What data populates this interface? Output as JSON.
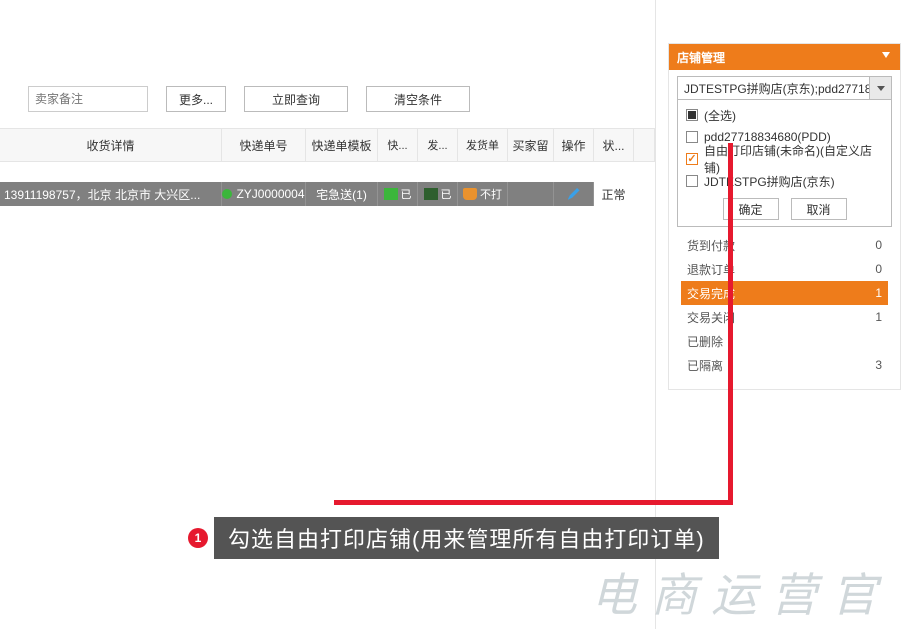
{
  "toolbar": {
    "placeholder_note": "卖家备注",
    "btn_more": "更多...",
    "btn_query": "立即查询",
    "btn_clear": "清空条件"
  },
  "columns": {
    "recv": "收货详情",
    "trk": "快递单号",
    "tpl": "快递单模板",
    "exp": "快...",
    "send": "发...",
    "ship": "发货单",
    "buyer": "买家留",
    "op": "操作",
    "stat": "状..."
  },
  "row": {
    "recv": "13911198757，北京 北京市 大兴区...",
    "trk": "ZYJ0000004",
    "tpl": "宅急送(1)",
    "exp_txt": "已",
    "send_txt": "已",
    "ship_txt": "不打",
    "stat": "正常"
  },
  "panel": {
    "title": "店铺管理",
    "select_text": "JDTESTPG拼购店(京东);pdd27718...",
    "opts": {
      "all": "(全选)",
      "pdd": "pdd27718834680(PDD)",
      "free": "自由打印店铺(未命名)(自定义店铺)",
      "jd": "JDTESTPG拼购店(京东)"
    },
    "btn_ok": "确定",
    "btn_cancel": "取消"
  },
  "stats": [
    {
      "label": "货到付款",
      "value": "0"
    },
    {
      "label": "退款订单",
      "value": "0"
    },
    {
      "label": "交易完成",
      "value": "1",
      "active": true
    },
    {
      "label": "交易关闭",
      "value": "1"
    },
    {
      "label": "已删除",
      "value": ""
    },
    {
      "label": "已隔离",
      "value": "3"
    }
  ],
  "callout": {
    "num": "1",
    "text": "勾选自由打印店铺(用来管理所有自由打印订单)"
  },
  "watermark": "电商运营官"
}
